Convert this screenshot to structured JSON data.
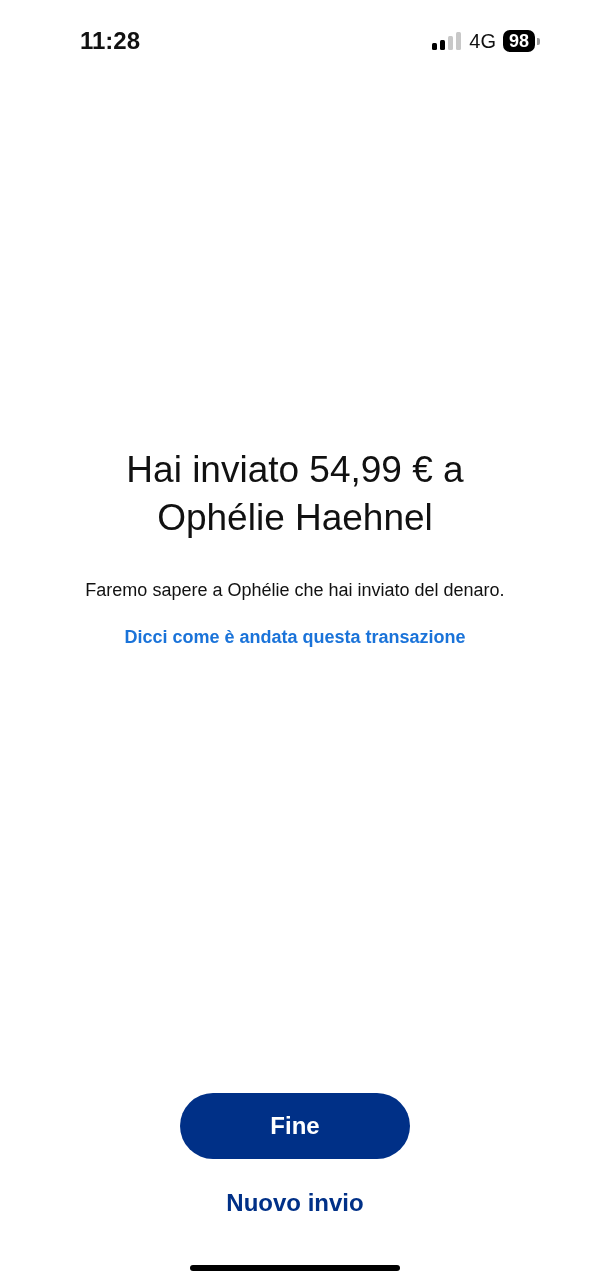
{
  "status_bar": {
    "time": "11:28",
    "network": "4G",
    "battery": "98"
  },
  "confirmation": {
    "title": "Hai inviato 54,99 € a Ophélie Haehnel",
    "message": "Faremo sapere a Ophélie che hai inviato del denaro.",
    "feedback_link": "Dicci come è andata questa transazione"
  },
  "buttons": [
    {
      "kind": "primary",
      "label": "Fine"
    },
    {
      "kind": "text",
      "label": "Nuovo invio"
    }
  ]
}
